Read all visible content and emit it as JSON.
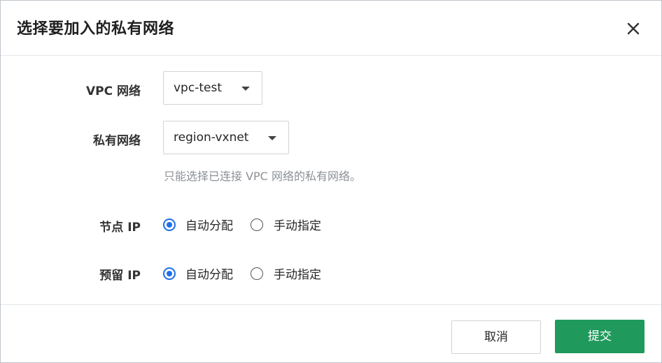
{
  "dialog": {
    "title": "选择要加入的私有网络",
    "close_icon": "close-icon"
  },
  "form": {
    "vpc": {
      "label": "VPC 网络",
      "value": "vpc-test"
    },
    "vxnet": {
      "label": "私有网络",
      "value": "region-vxnet",
      "hint": "只能选择已连接 VPC 网络的私有网络。"
    },
    "node_ip": {
      "label": "节点 IP",
      "options": [
        {
          "label": "自动分配",
          "selected": true
        },
        {
          "label": "手动指定",
          "selected": false
        }
      ]
    },
    "reserved_ip": {
      "label": "预留 IP",
      "options": [
        {
          "label": "自动分配",
          "selected": true
        },
        {
          "label": "手动指定",
          "selected": false
        }
      ]
    }
  },
  "footer": {
    "cancel_label": "取消",
    "submit_label": "提交"
  },
  "colors": {
    "accent": "#1e6fe8",
    "primary_button": "#1f9a5c"
  }
}
